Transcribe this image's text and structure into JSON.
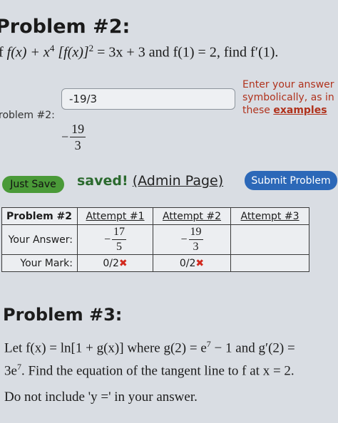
{
  "problem2": {
    "heading": "Problem #2:",
    "statement_prefix": "f ",
    "statement_eq": "f(x) + x",
    "statement_exp1": "4",
    "statement_eq2": " [f(x)]",
    "statement_exp2": "2",
    "statement_eq3": " = 3x + 3  and  f(1) = 2,  find f′(1).",
    "answer_value": "-19/3",
    "row_label": "roblem #2:",
    "preview_sign": "−",
    "preview_num": "19",
    "preview_den": "3"
  },
  "hint": {
    "line1": "Enter your answer",
    "line2": "symbolically, as in",
    "line3_prefix": "these ",
    "line3_link": "examples"
  },
  "actions": {
    "just_save": "Just Save",
    "saved_bold": "saved!",
    "admin_link": "(Admin Page)",
    "submit": "Submit Problem"
  },
  "results": {
    "headers": [
      "Problem #2",
      "Attempt #1",
      "Attempt #2",
      "Attempt #3"
    ],
    "your_answer_label": "Your Answer:",
    "your_mark_label": "Your Mark:",
    "attempt1_answer": {
      "sign": "−",
      "num": "17",
      "den": "5"
    },
    "attempt2_answer": {
      "sign": "−",
      "num": "19",
      "den": "3"
    },
    "attempt1_mark": "0/2",
    "attempt2_mark": "0/2",
    "mark_symbol": "✖"
  },
  "problem3": {
    "heading": "Problem #3:",
    "line1_a": "Let f(x) = ln[1 + g(x)] where g(2) = e",
    "line1_exp": "7",
    "line1_b": " − 1 and g′(2) =",
    "line2_a": "3e",
    "line2_exp": "7",
    "line2_b": ". Find the equation of the tangent line to f at x = 2.",
    "note": "Do not include 'y =' in your answer."
  },
  "colors": {
    "background": "#d9dde3",
    "hint_red": "#b0321c",
    "save_green": "#4a9a38",
    "submit_blue": "#2c68b8",
    "mark_red": "#d2291e"
  }
}
